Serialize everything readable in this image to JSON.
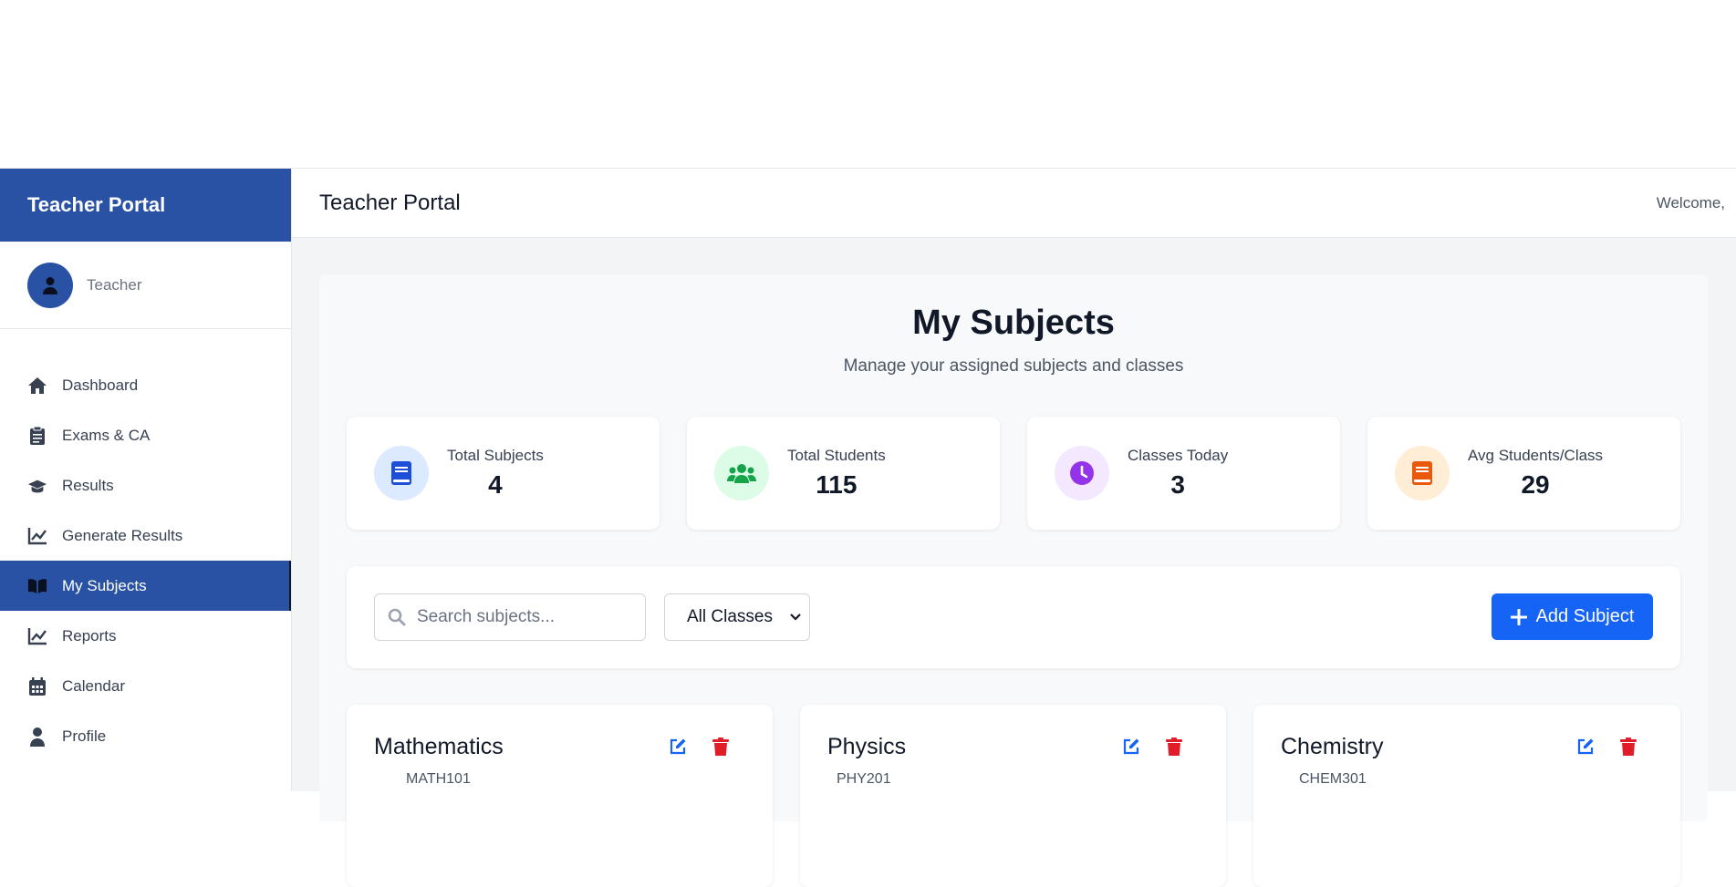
{
  "app": {
    "brand": "Teacher Portal"
  },
  "user": {
    "role": "Teacher"
  },
  "sidebar": {
    "items": [
      {
        "label": "Dashboard",
        "icon": "home-icon"
      },
      {
        "label": "Exams & CA",
        "icon": "clipboard-icon"
      },
      {
        "label": "Results",
        "icon": "graduation-cap-icon"
      },
      {
        "label": "Generate Results",
        "icon": "chart-line-icon"
      },
      {
        "label": "My Subjects",
        "icon": "book-open-icon",
        "active": true
      },
      {
        "label": "Reports",
        "icon": "chart-line-icon"
      },
      {
        "label": "Calendar",
        "icon": "calendar-icon"
      },
      {
        "label": "Profile",
        "icon": "user-icon"
      }
    ]
  },
  "header": {
    "title": "Teacher Portal",
    "welcome": "Welcome,"
  },
  "page": {
    "title": "My Subjects",
    "subtitle": "Manage your assigned subjects and classes"
  },
  "stats": [
    {
      "label": "Total Subjects",
      "value": "4",
      "icon": "book-icon",
      "color": "#1d4ed8",
      "bg": "#dbeafe"
    },
    {
      "label": "Total Students",
      "value": "115",
      "icon": "users-icon",
      "color": "#16a34a",
      "bg": "#dcfce7"
    },
    {
      "label": "Classes Today",
      "value": "3",
      "icon": "clock-icon",
      "color": "#9333ea",
      "bg": "#f3e8ff"
    },
    {
      "label": "Avg Students/Class",
      "value": "29",
      "icon": "book-icon",
      "color": "#ea580c",
      "bg": "#ffedd5"
    }
  ],
  "toolbar": {
    "search_placeholder": "Search subjects...",
    "class_filter": "All Classes",
    "add_label": "Add Subject",
    "accent": "#1664f5"
  },
  "subjects": [
    {
      "name": "Mathematics",
      "code": "MATH101"
    },
    {
      "name": "Physics",
      "code": "PHY201"
    },
    {
      "name": "Chemistry",
      "code": "CHEM301"
    }
  ]
}
